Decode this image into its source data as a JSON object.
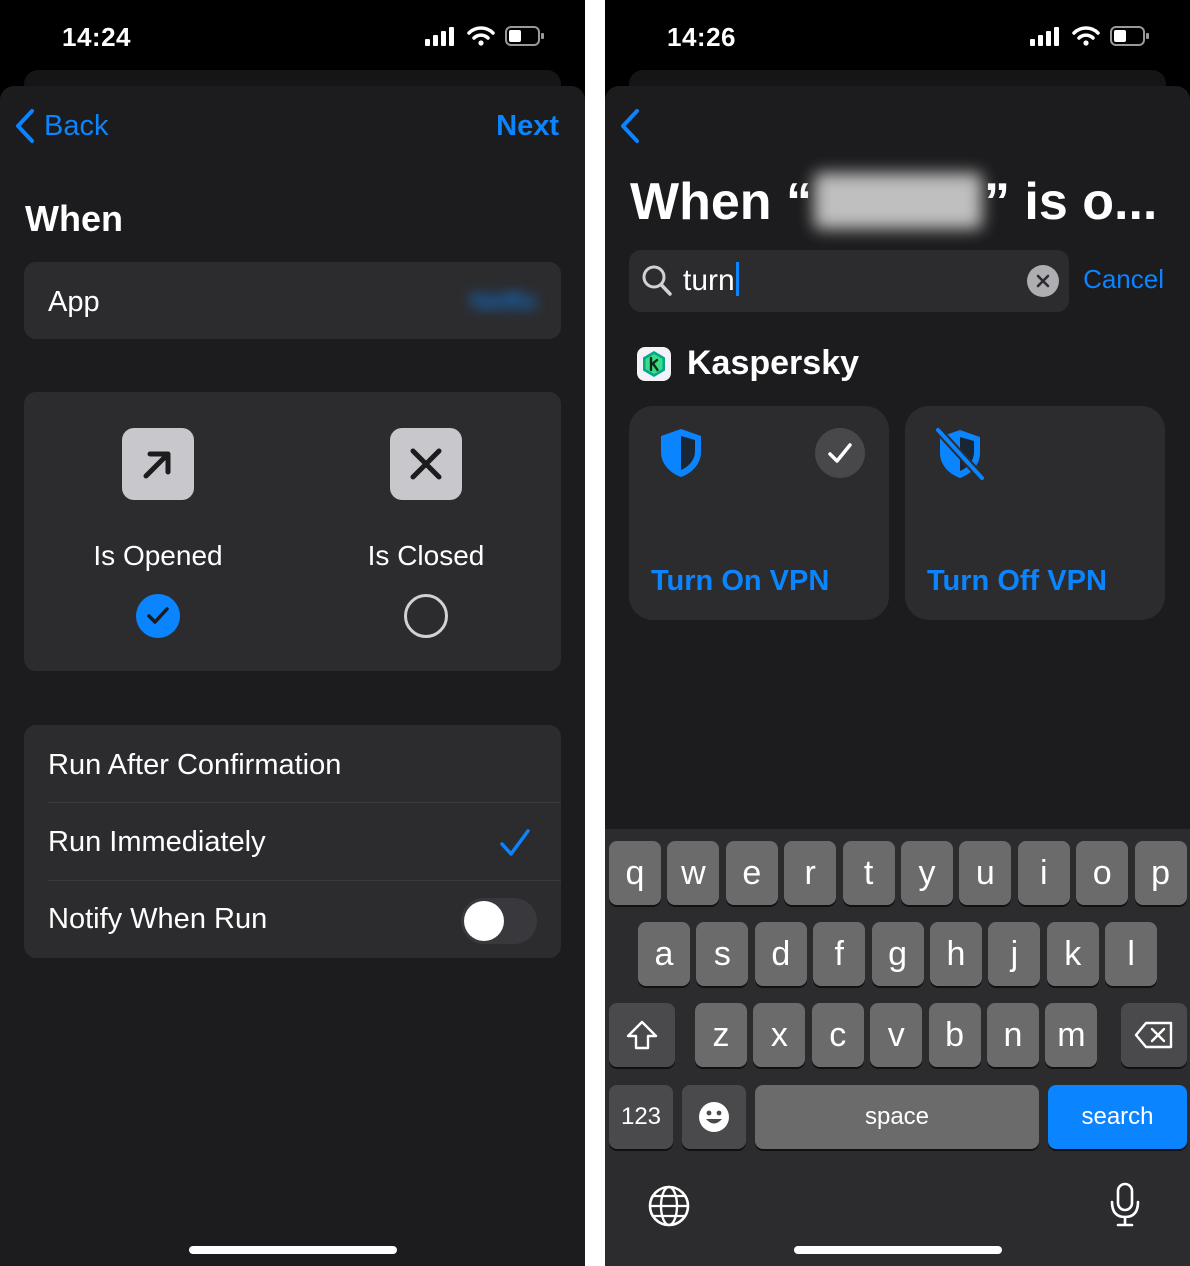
{
  "left": {
    "status": {
      "time": "14:24"
    },
    "nav": {
      "back": "Back",
      "next": "Next"
    },
    "section_title": "When",
    "app_row": {
      "label": "App",
      "value": "Netflix"
    },
    "states": [
      {
        "label": "Is Opened",
        "selected": true,
        "icon": "arrow-up-right-icon"
      },
      {
        "label": "Is Closed",
        "selected": false,
        "icon": "x-mark-icon"
      }
    ],
    "options": [
      {
        "label": "Run After Confirmation",
        "checked": false
      },
      {
        "label": "Run Immediately",
        "checked": true
      }
    ],
    "notify": {
      "label": "Notify When Run",
      "on": false
    }
  },
  "right": {
    "status": {
      "time": "14:26"
    },
    "title_prefix": "When “",
    "title_suffix": "” is o...",
    "search": {
      "value": "turn",
      "cancel": "Cancel"
    },
    "provider": "Kaspersky",
    "actions": [
      {
        "label": "Turn On VPN",
        "icon": "shield-icon",
        "selected": true
      },
      {
        "label": "Turn Off VPN",
        "icon": "shield-slash-icon",
        "selected": false
      }
    ],
    "keyboard": {
      "row1": [
        "q",
        "w",
        "e",
        "r",
        "t",
        "y",
        "u",
        "i",
        "o",
        "p"
      ],
      "row2": [
        "a",
        "s",
        "d",
        "f",
        "g",
        "h",
        "j",
        "k",
        "l"
      ],
      "row3": [
        "z",
        "x",
        "c",
        "v",
        "b",
        "n",
        "m"
      ],
      "numbers": "123",
      "space": "space",
      "search": "search"
    }
  },
  "colors": {
    "accent": "#0a84ff",
    "background": "#1c1c1e",
    "card": "#2c2c2e"
  }
}
